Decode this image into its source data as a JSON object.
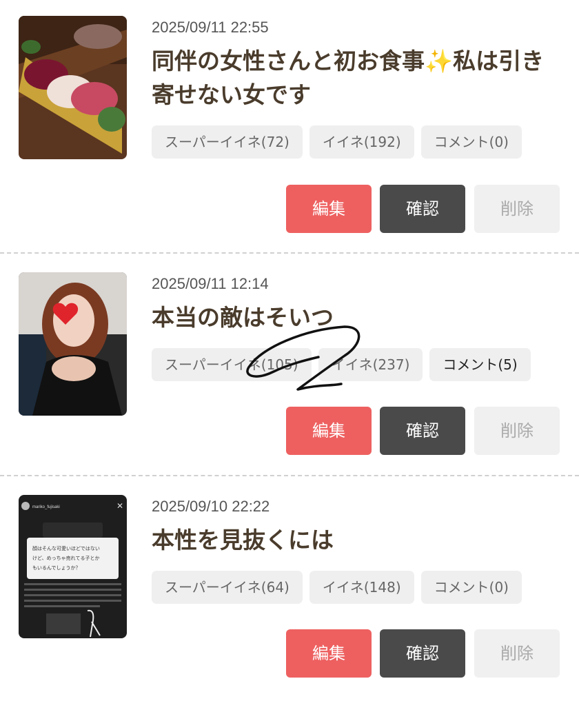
{
  "posts": [
    {
      "datetime": "2025/09/11 22:55",
      "title": "同伴の女性さんと初お食事✨私は引き寄せない女です",
      "tags": {
        "super_like": "スーパーイイネ(72)",
        "like": "イイネ(192)",
        "comment": "コメント(0)"
      },
      "buttons": {
        "edit": "編集",
        "confirm": "確認",
        "delete": "削除"
      }
    },
    {
      "datetime": "2025/09/11 12:14",
      "title": "本当の敵はそいつ",
      "tags": {
        "super_like": "スーパーイイネ(105)",
        "like": "イイネ(237)",
        "comment": "コメント(5)"
      },
      "buttons": {
        "edit": "編集",
        "confirm": "確認",
        "delete": "削除"
      }
    },
    {
      "datetime": "2025/09/10 22:22",
      "title": "本性を見抜くには",
      "tags": {
        "super_like": "スーパーイイネ(64)",
        "like": "イイネ(148)",
        "comment": "コメント(0)"
      },
      "buttons": {
        "edit": "編集",
        "confirm": "確認",
        "delete": "削除"
      },
      "thumbnail_text": {
        "username": "mariko_fujisaki",
        "question": "顔はそんな可愛いほどではないけど、めっちゃ売れてる子とかもいるんでしょうか？"
      }
    }
  ],
  "colors": {
    "edit": "#ee6060",
    "confirm": "#4a4a4a",
    "delete": "#f0f0f0",
    "title": "#4a3c2c"
  }
}
